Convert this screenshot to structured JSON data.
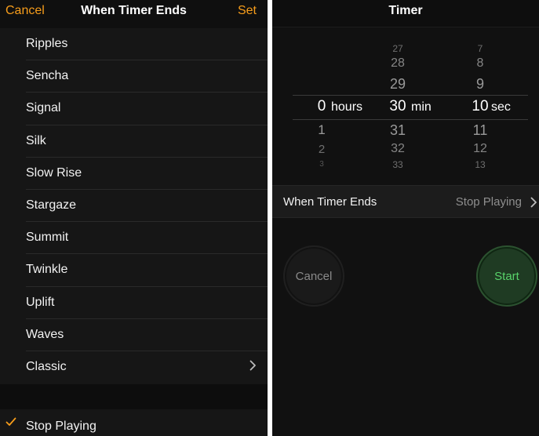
{
  "left_panel": {
    "nav": {
      "cancel": "Cancel",
      "title": "When Timer Ends",
      "set": "Set"
    },
    "tones": [
      {
        "label": "Ripples"
      },
      {
        "label": "Sencha"
      },
      {
        "label": "Signal"
      },
      {
        "label": "Silk"
      },
      {
        "label": "Slow Rise"
      },
      {
        "label": "Stargaze"
      },
      {
        "label": "Summit"
      },
      {
        "label": "Twinkle"
      },
      {
        "label": "Uplift"
      },
      {
        "label": "Waves"
      },
      {
        "label": "Classic"
      }
    ],
    "stop_playing": "Stop Playing",
    "accent_color": "#f79d1b"
  },
  "right_panel": {
    "title": "Timer",
    "picker": {
      "hours": {
        "above": [
          "",
          "",
          ""
        ],
        "selected": "0",
        "unit": "hours",
        "below": [
          "1",
          "2",
          "3"
        ]
      },
      "minutes": {
        "above": [
          "27",
          "28",
          "29"
        ],
        "selected": "30",
        "unit": "min",
        "below": [
          "31",
          "32",
          "33"
        ]
      },
      "seconds": {
        "above": [
          "7",
          "8",
          "9"
        ],
        "selected": "10",
        "unit": "sec",
        "below": [
          "11",
          "12",
          "13"
        ]
      }
    },
    "when_timer_ends": {
      "label": "When Timer Ends",
      "value": "Stop Playing"
    },
    "buttons": {
      "cancel": "Cancel",
      "start": "Start"
    },
    "start_color": "#58d36a"
  }
}
